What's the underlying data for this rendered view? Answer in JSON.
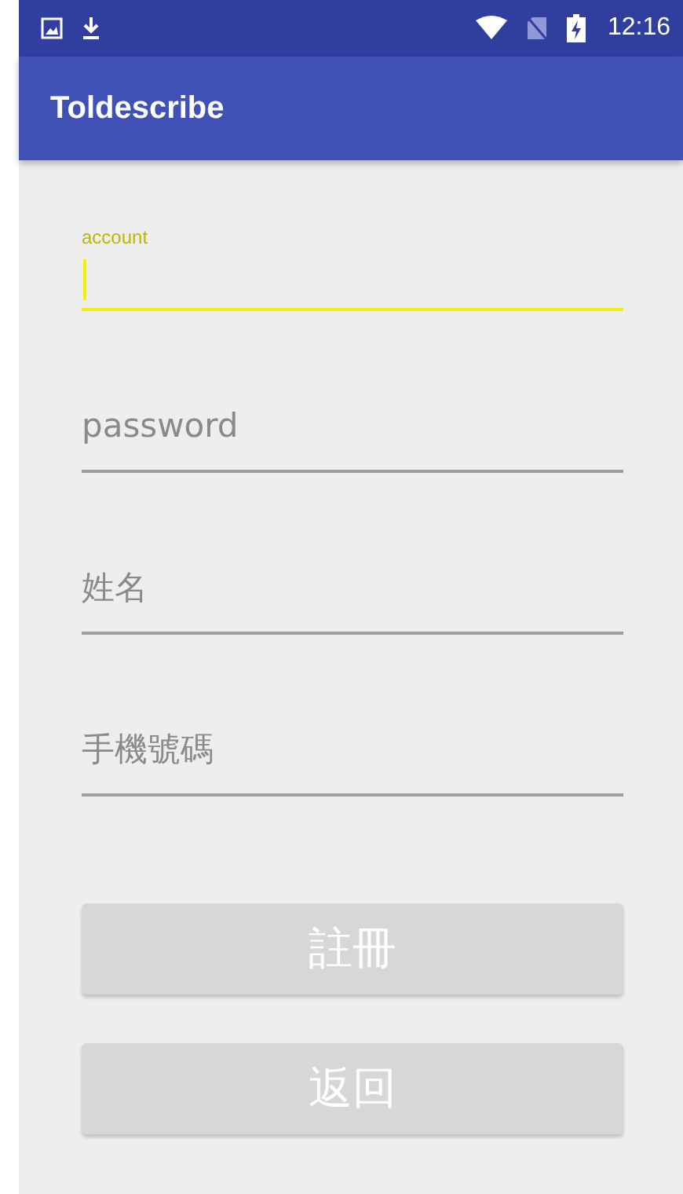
{
  "status_bar": {
    "time": "12:16"
  },
  "toolbar": {
    "title": "Toldescribe"
  },
  "fields": [
    {
      "placeholder": "account",
      "focused": true
    },
    {
      "placeholder": "password",
      "focused": false
    },
    {
      "placeholder": "姓名",
      "focused": false
    },
    {
      "placeholder": "手機號碼",
      "focused": false
    }
  ],
  "buttons": [
    {
      "label": "註冊"
    },
    {
      "label": "返回"
    }
  ]
}
